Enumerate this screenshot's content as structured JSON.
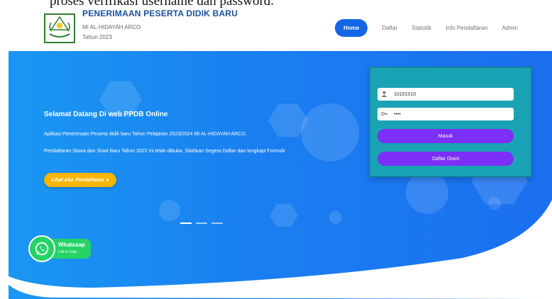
{
  "caption": {
    "text": "proses verifikasi username dan password."
  },
  "header": {
    "title": "PENERIMAAN PESERTA DIDIK BARU",
    "school": "MI AL-HIDAYAH ARCO",
    "year": "Tahun 2023"
  },
  "nav": {
    "items": [
      "Home",
      "Daftar",
      "Statistik",
      "Info Pendaftaran",
      "Admin"
    ],
    "active": "Home"
  },
  "hero": {
    "title": "Selamat Datang Di web PPDB Online",
    "p1": "Aplikasi Penerimaan Peserta didik baru Tahun Pelajaran 2023/2024 MI AL-HIDAYAH ARCO.",
    "p2": "Pendaftaran Siswa dan Siswi Baru Tahun 2022 ini telah dibuka. Silahkan Segera Daftar dan lengkapi Formulir",
    "cta": "Lihat Alur Pendaftaran ∨"
  },
  "login": {
    "username_value": "10101010",
    "password_value": "••••",
    "login_label": "Masuk",
    "register_label": "Daftar Disini"
  },
  "whatsapp": {
    "title": "Whatsaap",
    "subtitle": "Clik to Chat"
  },
  "colors": {
    "accent": "#1565e6",
    "hero_blue": "#1a7ff0",
    "login_card": "#1aa3b5",
    "button_purple": "#7b2ff7",
    "cta_yellow": "#f7b500",
    "whatsapp_green": "#25d366"
  },
  "icons": [
    "logo-emblem",
    "user-icon",
    "key-icon",
    "whatsapp-icon"
  ]
}
